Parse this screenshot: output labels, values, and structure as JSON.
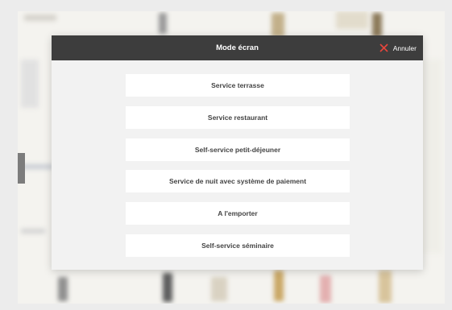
{
  "modal": {
    "title": "Mode écran",
    "cancel_label": "Annuler",
    "cancel_icon": "close-icon",
    "cancel_icon_color": "#e8453c",
    "header_color": "#3d3d3d"
  },
  "options": [
    {
      "label": "Service terrasse"
    },
    {
      "label": "Service restaurant"
    },
    {
      "label": "Self-service petit-déjeuner"
    },
    {
      "label": "Service de nuit avec système de paiement"
    },
    {
      "label": "A l'emporter"
    },
    {
      "label": "Self-service séminaire"
    }
  ]
}
